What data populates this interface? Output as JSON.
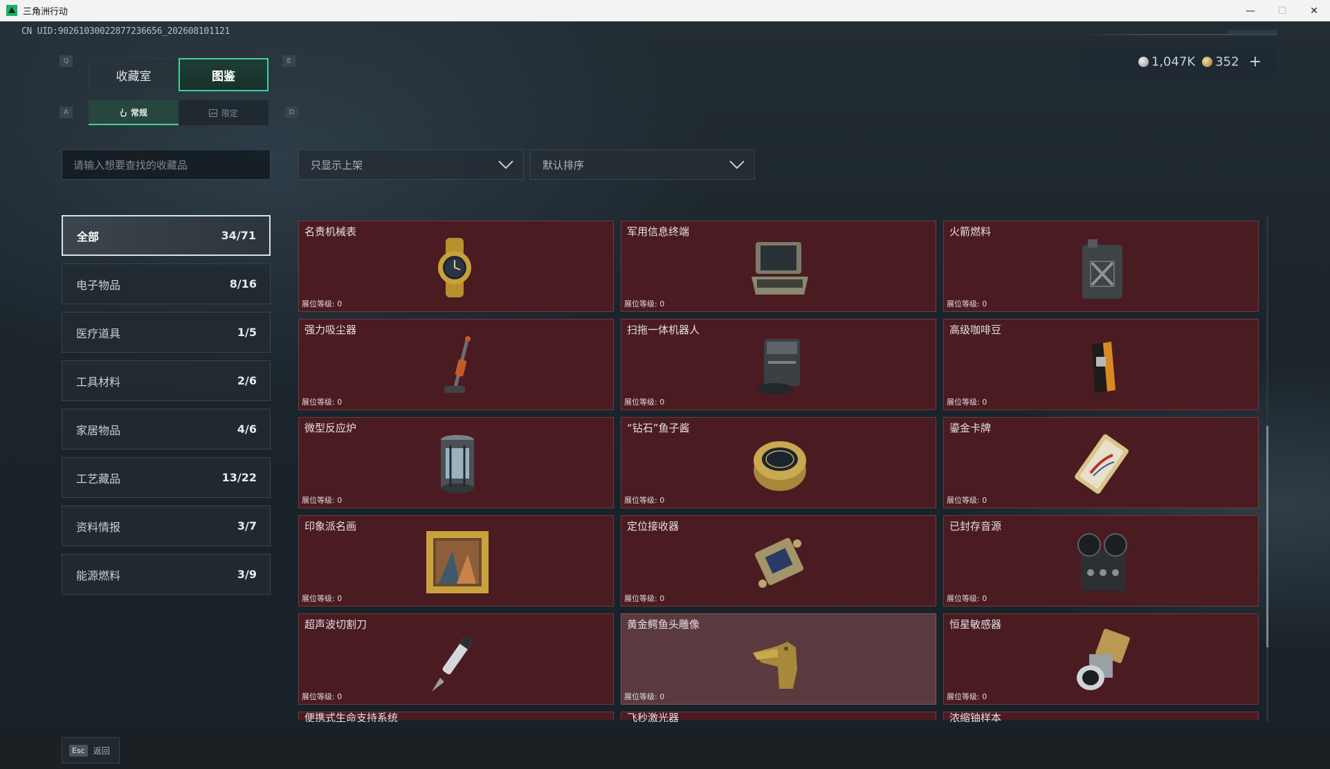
{
  "window": {
    "title": "三角洲行动",
    "minimize": "—",
    "maximize": "☐",
    "close": "✕"
  },
  "uid": "CN UID:90261030022877236656_202608101121",
  "currency": {
    "silver": "1,047K",
    "gold": "352",
    "plus": "+"
  },
  "keys": {
    "prev_tab": "Q",
    "next_tab": "E",
    "prev_sub": "A",
    "next_sub": "D"
  },
  "tabs": [
    {
      "label": "收藏室"
    },
    {
      "label": "图鉴"
    }
  ],
  "subtabs": [
    {
      "label": "常规"
    },
    {
      "label": "限定"
    }
  ],
  "search": {
    "placeholder": "请输入想要查找的收藏品"
  },
  "filter": {
    "value": "只显示上架"
  },
  "sort": {
    "value": "默认排序"
  },
  "categories": [
    {
      "label": "全部",
      "count": "34/71"
    },
    {
      "label": "电子物品",
      "count": "8/16"
    },
    {
      "label": "医疗道具",
      "count": "1/5"
    },
    {
      "label": "工具材料",
      "count": "2/6"
    },
    {
      "label": "家居物品",
      "count": "4/6"
    },
    {
      "label": "工艺藏品",
      "count": "13/22"
    },
    {
      "label": "资料情报",
      "count": "3/7"
    },
    {
      "label": "能源燃料",
      "count": "3/9"
    }
  ],
  "level_label": "展位等级: 0",
  "items": [
    {
      "name": "名贵机械表",
      "icon": "watch-icon"
    },
    {
      "name": "军用信息终端",
      "icon": "terminal-icon"
    },
    {
      "name": "火箭燃料",
      "icon": "fuel-can-icon"
    },
    {
      "name": "强力吸尘器",
      "icon": "vacuum-icon"
    },
    {
      "name": "扫拖一体机器人",
      "icon": "robot-vacuum-icon"
    },
    {
      "name": "高级咖啡豆",
      "icon": "coffee-bag-icon"
    },
    {
      "name": "微型反应炉",
      "icon": "reactor-icon"
    },
    {
      "name": "“钻石”鱼子酱",
      "icon": "caviar-tin-icon"
    },
    {
      "name": "鎏金卡牌",
      "icon": "gold-card-icon"
    },
    {
      "name": "印象派名画",
      "icon": "painting-icon"
    },
    {
      "name": "定位接收器",
      "icon": "receiver-icon"
    },
    {
      "name": "已封存音源",
      "icon": "reel-recorder-icon"
    },
    {
      "name": "超声波切割刀",
      "icon": "cutter-icon"
    },
    {
      "name": "黄金鳄鱼头雕像",
      "icon": "croc-statue-icon"
    },
    {
      "name": "恒星敏感器",
      "icon": "star-sensor-icon"
    },
    {
      "name": "便携式生命支持系统",
      "icon": ""
    },
    {
      "name": "飞秒激光器",
      "icon": ""
    },
    {
      "name": "浓缩铀样本",
      "icon": ""
    }
  ],
  "esc": {
    "key": "Esc",
    "label": "返回"
  },
  "colors": {
    "accent": "#3fd39a",
    "card_bg": "#4a1c22"
  }
}
